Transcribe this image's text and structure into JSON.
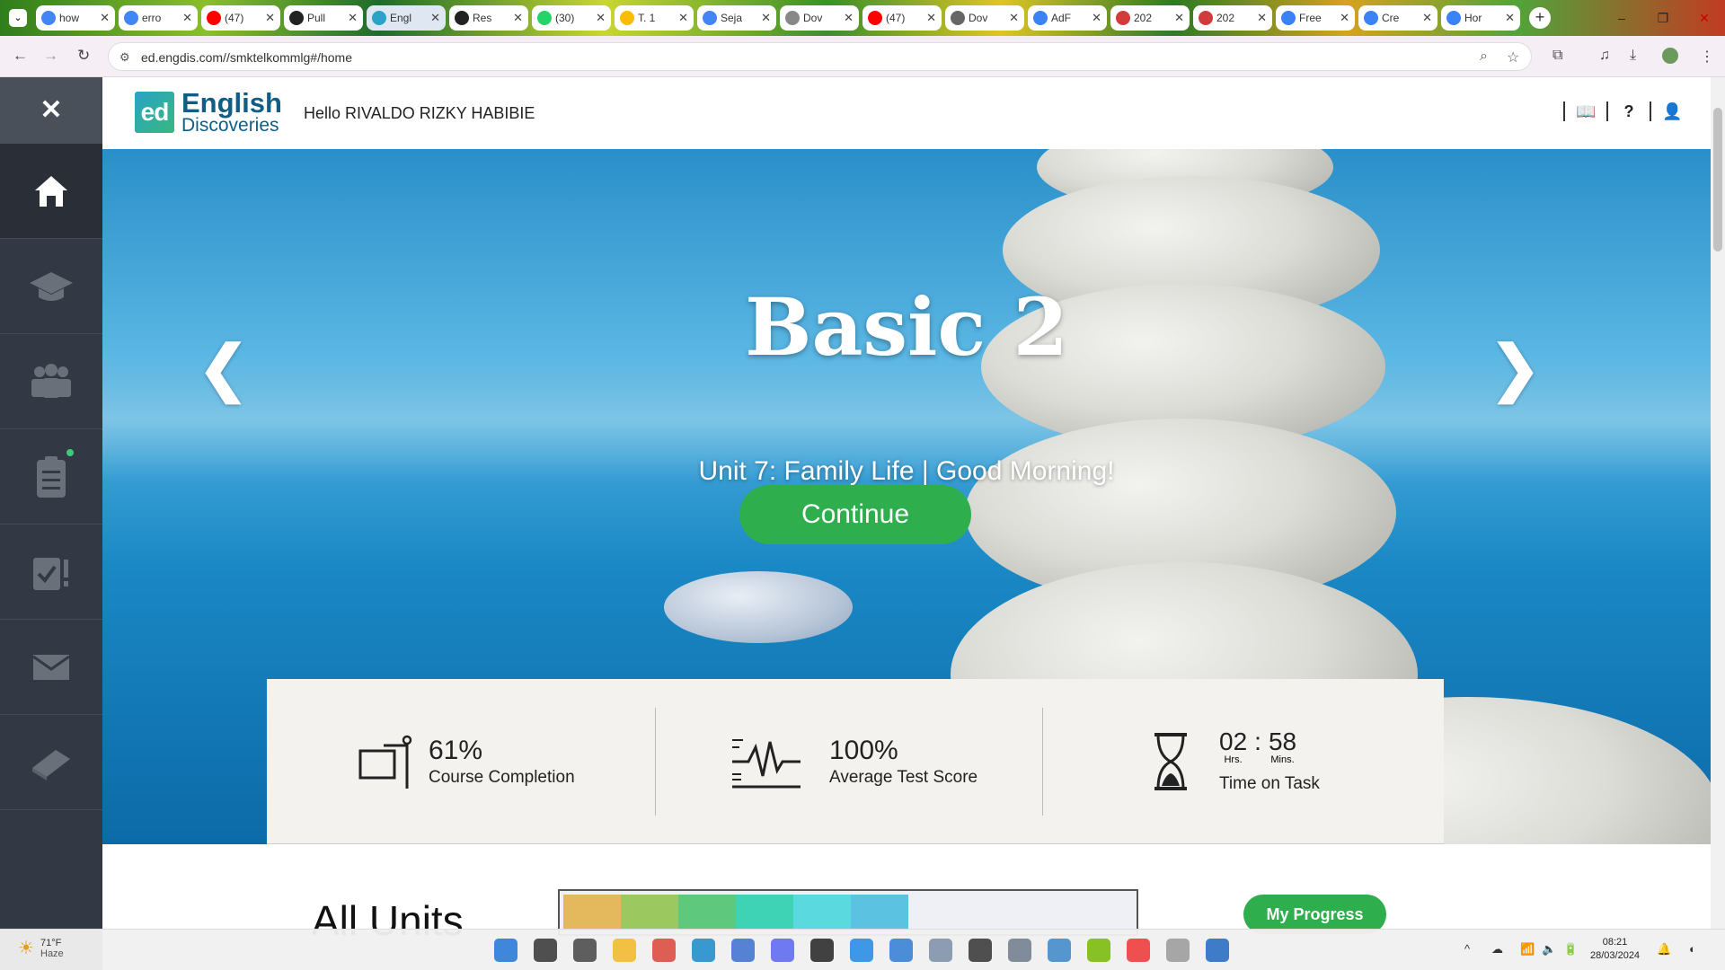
{
  "browser": {
    "tabs": [
      {
        "title": "how",
        "favicon": "google-icon",
        "color": "#4285f4"
      },
      {
        "title": "erro",
        "favicon": "google-icon",
        "color": "#4285f4"
      },
      {
        "title": "(47)",
        "favicon": "youtube-icon",
        "color": "#ff0000"
      },
      {
        "title": "Pull",
        "favicon": "github-icon",
        "color": "#222222"
      },
      {
        "title": "Engl",
        "favicon": "english-discoveries-icon",
        "color": "#2aa3c8",
        "active": true
      },
      {
        "title": "Res",
        "favicon": "github-icon",
        "color": "#222222"
      },
      {
        "title": "(30)",
        "favicon": "whatsapp-icon",
        "color": "#25d366"
      },
      {
        "title": "T. 1",
        "favicon": "drive-icon",
        "color": "#fbbc04"
      },
      {
        "title": "Seja",
        "favicon": "docs-icon",
        "color": "#4285f4"
      },
      {
        "title": "Dov",
        "favicon": "folder-icon",
        "color": "#888888"
      },
      {
        "title": "(47)",
        "favicon": "youtube-icon",
        "color": "#ff0000"
      },
      {
        "title": "Dov",
        "favicon": "globe-icon",
        "color": "#666666"
      },
      {
        "title": "AdF",
        "favicon": "link-icon",
        "color": "#3b82f6"
      },
      {
        "title": "202",
        "favicon": "bird-icon",
        "color": "#d23b3b"
      },
      {
        "title": "202",
        "favicon": "bird-icon",
        "color": "#d23b3b"
      },
      {
        "title": "Free",
        "favicon": "chrome-icon",
        "color": "#3b82f6"
      },
      {
        "title": "Cre",
        "favicon": "chrome-icon",
        "color": "#3b82f6"
      },
      {
        "title": "Hor",
        "favicon": "chrome-icon",
        "color": "#3b82f6"
      }
    ],
    "url": "ed.engdis.com//smktelkommlg#/home"
  },
  "header": {
    "logo_mark": "ed",
    "logo_line1": "English",
    "logo_line2": "Discoveries",
    "greeting": "Hello RIVALDO RIZKY HABIBIE"
  },
  "sidebar": {
    "close_label": "✕",
    "items": [
      {
        "name": "home-icon",
        "active": true
      },
      {
        "name": "graduation-cap-icon"
      },
      {
        "name": "community-icon"
      },
      {
        "name": "assignments-icon",
        "notification": true
      },
      {
        "name": "tests-icon"
      },
      {
        "name": "messages-icon"
      },
      {
        "name": "book-icon"
      }
    ]
  },
  "hero": {
    "title": "Basic 2",
    "subtitle": "Unit 7: Family Life |  Good Morning!",
    "continue_label": "Continue",
    "prev_arrow": "❮",
    "next_arrow": "❯"
  },
  "stats": {
    "completion": {
      "value": "61%",
      "label": "Course Completion"
    },
    "test_score": {
      "value": "100%",
      "label": "Average Test Score"
    },
    "time": {
      "hours": "02",
      "minutes": "58",
      "sep": ":",
      "hours_label": "Hrs.",
      "minutes_label": "Mins.",
      "label": "Time on Task"
    }
  },
  "units": {
    "title": "All Units",
    "progress_colors": [
      "#e4b95e",
      "#9cc95f",
      "#5ec97c",
      "#3ed3b4",
      "#5ad9df",
      "#5cc2e2"
    ],
    "my_progress_label": "My Progress"
  },
  "taskbar": {
    "weather_temp": "71°F",
    "weather_desc": "Haze",
    "time": "08:21",
    "date": "28/03/2024"
  }
}
